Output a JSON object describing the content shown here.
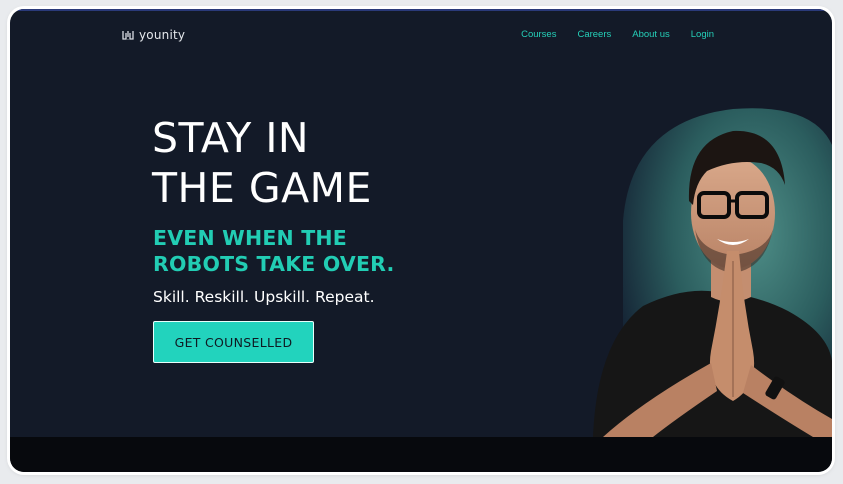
{
  "brand": {
    "name": "younity",
    "icon": "younity-logo-icon"
  },
  "nav": {
    "items": [
      {
        "label": "Courses"
      },
      {
        "label": "Careers"
      },
      {
        "label": "About us"
      },
      {
        "label": "Login"
      }
    ]
  },
  "hero": {
    "title_line1": "STAY IN",
    "title_line2": "THE GAME",
    "subtitle_line1": "EVEN WHEN THE",
    "subtitle_line2": "ROBOTS TAKE OVER.",
    "tagline": "Skill. Reskill. Upskill. Repeat.",
    "cta_label": "GET COUNSELLED"
  },
  "colors": {
    "background": "#131a28",
    "accent": "#22cdb4",
    "button": "#22d3bd",
    "footer_strip": "#07090d"
  }
}
